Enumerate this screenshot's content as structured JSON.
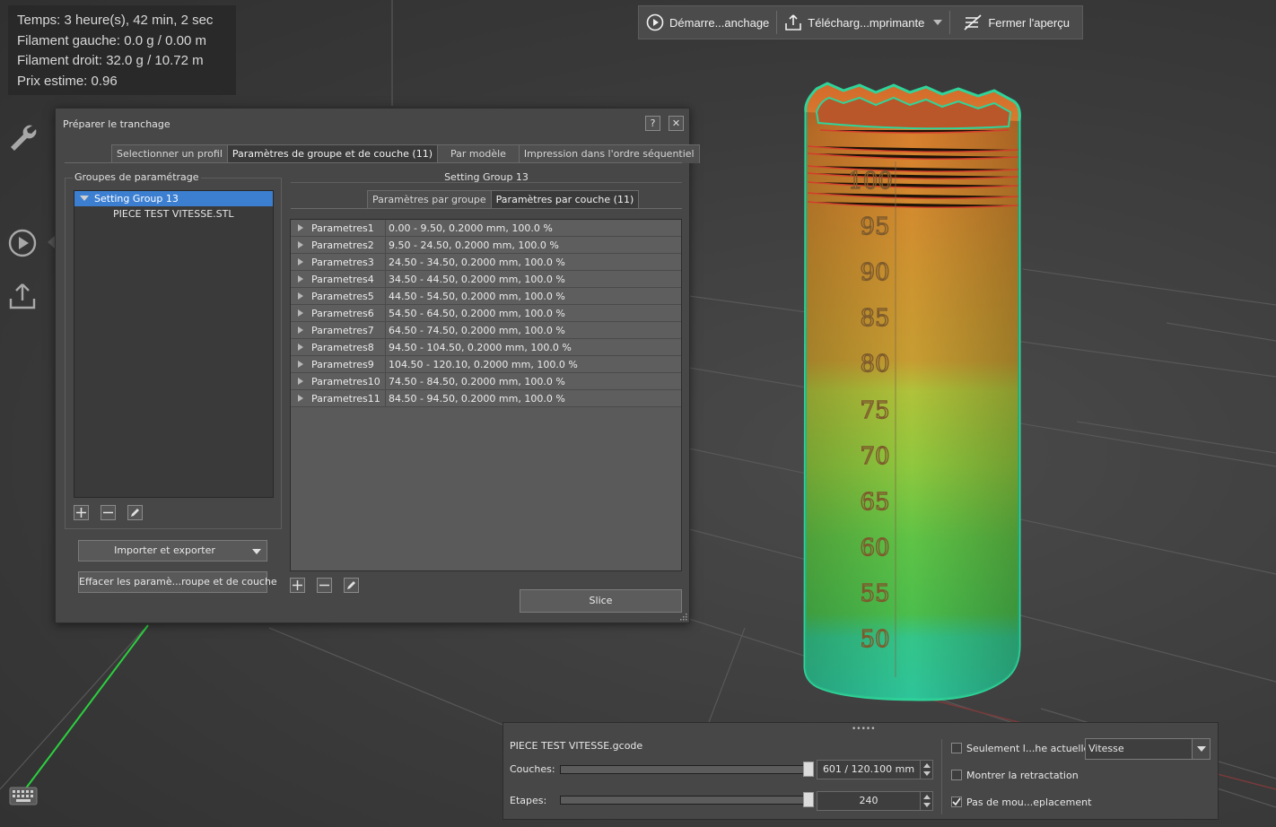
{
  "stats": {
    "time": "Temps: 3 heure(s), 42 min, 2 sec",
    "filament_left": "Filament gauche: 0.0 g / 0.00 m",
    "filament_right": "Filament droit: 32.0 g / 10.72 m",
    "price": "Prix estime: 0.96"
  },
  "left_tools": [
    "wrench-icon",
    "play-circle-icon",
    "upload-icon"
  ],
  "toolbar": {
    "start_slicing": "Démarre...anchage",
    "upload_printer": "Télécharg...mprimante",
    "close_preview": "Fermer l'aperçu"
  },
  "dialog": {
    "title": "Préparer le tranchage",
    "help": "?",
    "close": "✕",
    "tabs": [
      {
        "label": "Selectionner un profil",
        "active": false
      },
      {
        "label": "Paramètres de groupe et de couche (11)",
        "active": true
      },
      {
        "label": "Par modèle",
        "active": false
      },
      {
        "label": "Impression dans l'ordre séquentiel",
        "active": false
      }
    ],
    "groups_legend": "Groupes de paramétrage",
    "tree": [
      {
        "label": "Setting Group 13",
        "selected": true
      },
      {
        "label": "PIECE TEST VITESSE.STL",
        "selected": false
      }
    ],
    "import_export": "Importer et exporter",
    "clear_params": "Effacer les paramè...roupe et de couche",
    "setting_group_title": "Setting Group 13",
    "subtabs": [
      {
        "label": "Paramètres par groupe",
        "active": false
      },
      {
        "label": "Paramètres par couche (11)",
        "active": true
      }
    ],
    "params": [
      {
        "name": "Parametres1",
        "value": "0.00 - 9.50, 0.2000 mm, 100.0 %"
      },
      {
        "name": "Parametres2",
        "value": "9.50 - 24.50, 0.2000 mm, 100.0 %"
      },
      {
        "name": "Parametres3",
        "value": "24.50 - 34.50, 0.2000 mm, 100.0 %"
      },
      {
        "name": "Parametres4",
        "value": "34.50 - 44.50, 0.2000 mm, 100.0 %"
      },
      {
        "name": "Parametres5",
        "value": "44.50 - 54.50, 0.2000 mm, 100.0 %"
      },
      {
        "name": "Parametres6",
        "value": "54.50 - 64.50, 0.2000 mm, 100.0 %"
      },
      {
        "name": "Parametres7",
        "value": "64.50 - 74.50, 0.2000 mm, 100.0 %"
      },
      {
        "name": "Parametres8",
        "value": "94.50 - 104.50, 0.2000 mm, 100.0 %"
      },
      {
        "name": "Parametres9",
        "value": "104.50 - 120.10, 0.2000 mm, 100.0 %"
      },
      {
        "name": "Parametres10",
        "value": "74.50 - 84.50, 0.2000 mm, 100.0 %"
      },
      {
        "name": "Parametres11",
        "value": "84.50 - 94.50, 0.2000 mm, 100.0 %"
      }
    ],
    "slice": "Slice"
  },
  "model": {
    "scale_labels": [
      "100",
      "95",
      "90",
      "85",
      "80",
      "75",
      "70",
      "65",
      "60",
      "55",
      "50"
    ]
  },
  "bottom_panel": {
    "filename": "PIECE TEST VITESSE.gcode",
    "layers_label": "Couches:",
    "layers_value": "601 / 120.100 mm",
    "layers_fraction": 1.0,
    "steps_label": "Etapes:",
    "steps_value": "240",
    "steps_fraction": 1.0,
    "checks": [
      {
        "label": "Seulement l...he actuelle",
        "checked": false
      },
      {
        "label": "Montrer la retractation",
        "checked": false
      },
      {
        "label": "Pas de mou...eplacement",
        "checked": true
      }
    ],
    "view_mode": "Vitesse"
  },
  "colors": {
    "selection": "#3c7fd1",
    "grid_line": "#585858",
    "axis_green": "#2bd13f"
  }
}
